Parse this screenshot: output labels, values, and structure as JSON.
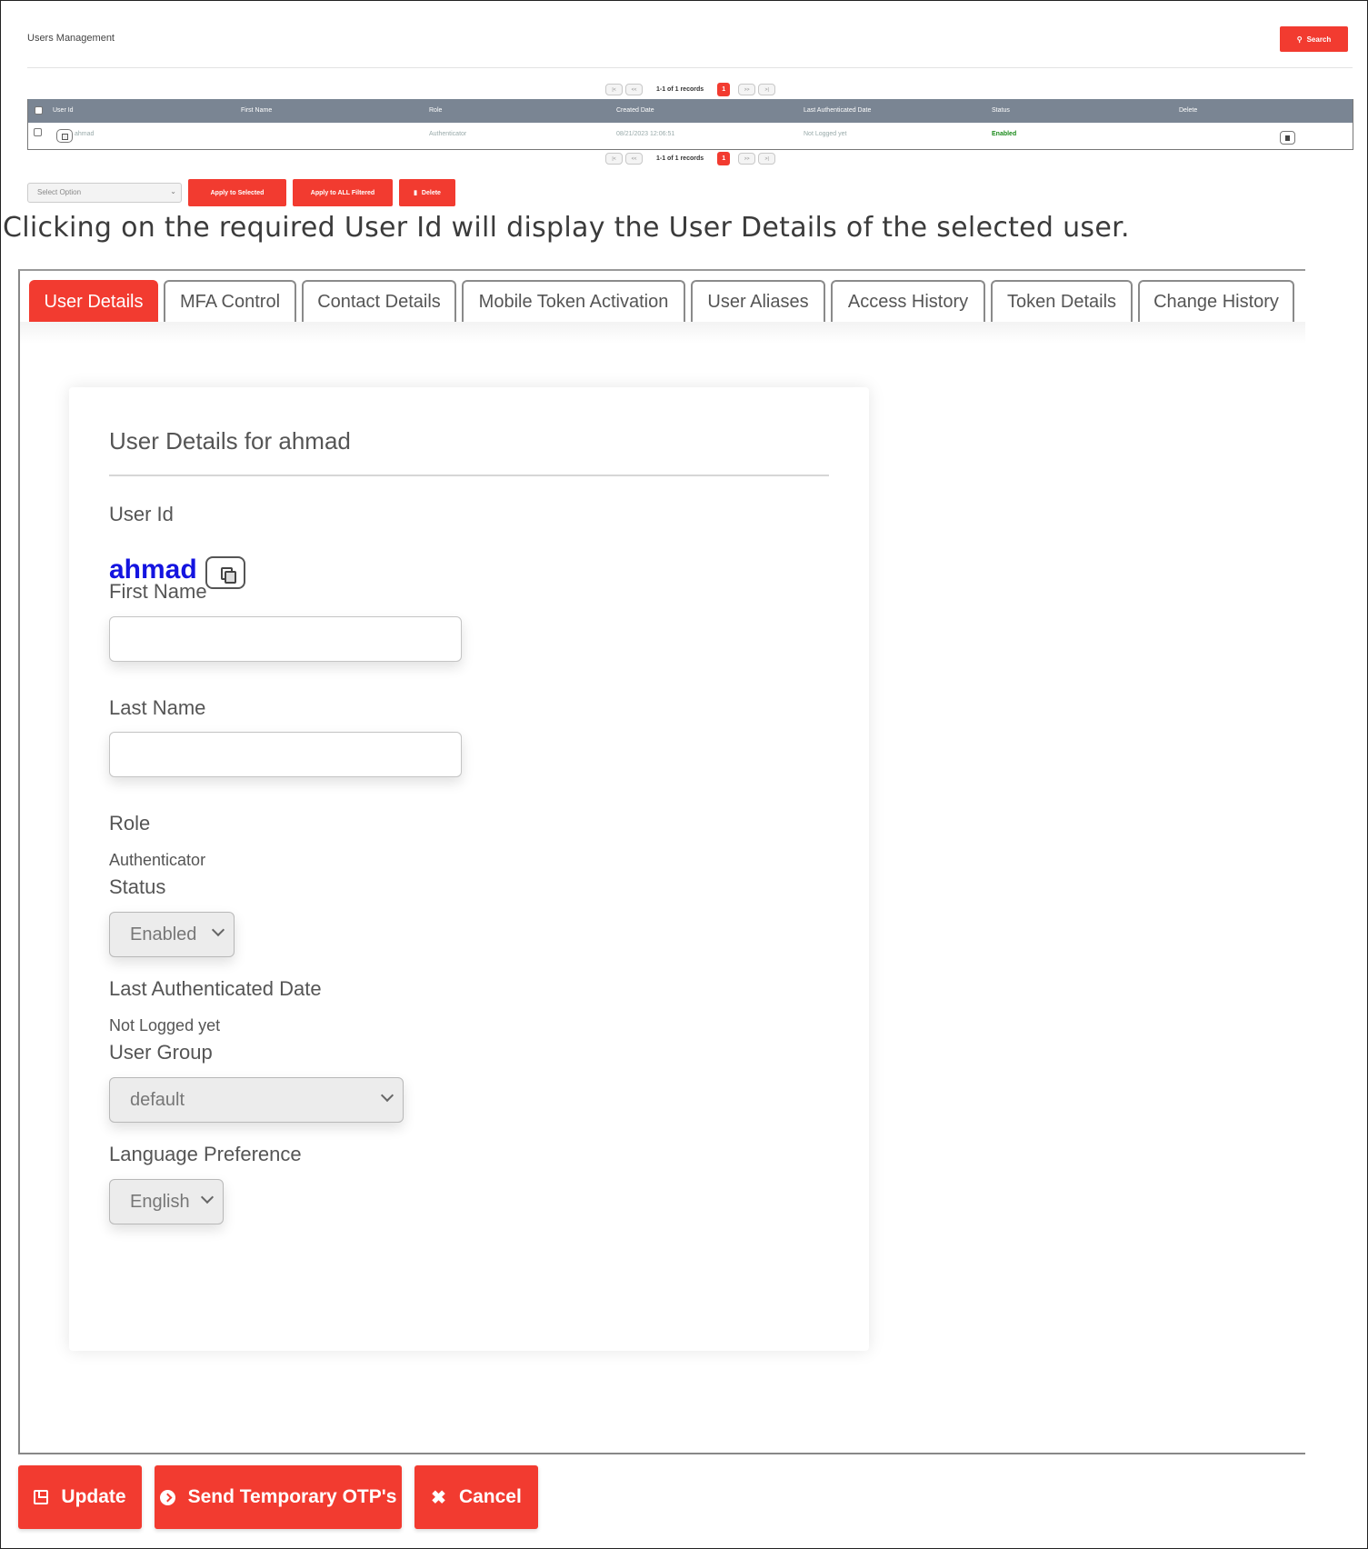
{
  "users_management": {
    "title": "Users Management",
    "search_label": "Search",
    "pager": {
      "info": "1-1 of 1 records",
      "current_page": "1",
      "first": "|<",
      "prev": "<<",
      "next": ">>",
      "last": ">|"
    },
    "columns": [
      "User Id",
      "First Name",
      "Role",
      "Created Date",
      "Last Authenticated Date",
      "Status",
      "Delete"
    ],
    "rows": [
      {
        "user_id": "ahmad",
        "first_name": "",
        "role": "Authenticator",
        "created_date": "08/21/2023 12:06:51",
        "last_authenticated": "Not Logged yet",
        "status": "Enabled"
      }
    ],
    "bulk": {
      "select_placeholder": "Select Option",
      "apply_selected": "Apply to Selected",
      "apply_all": "Apply to ALL Filtered",
      "delete": "Delete"
    }
  },
  "caption": "Clicking on the required User Id will display the User Details of the selected user.",
  "user_details": {
    "tabs": [
      {
        "label": "User Details",
        "active": true
      },
      {
        "label": "MFA Control",
        "active": false
      },
      {
        "label": "Contact Details",
        "active": false
      },
      {
        "label": "Mobile Token Activation",
        "active": false
      },
      {
        "label": "User Aliases",
        "active": false
      },
      {
        "label": "Access History",
        "active": false
      },
      {
        "label": "Token Details",
        "active": false
      },
      {
        "label": "Change History",
        "active": false
      }
    ],
    "card_title": "User Details for ahmad",
    "user_id_label": "User Id",
    "user_id_value": "ahmad",
    "first_name_label": "First Name",
    "first_name_value": "",
    "last_name_label": "Last Name",
    "last_name_value": "",
    "role_label": "Role",
    "role_value": "Authenticator",
    "status_label": "Status",
    "status_value": "Enabled",
    "last_auth_label": "Last Authenticated Date",
    "last_auth_value": "Not Logged yet",
    "user_group_label": "User Group",
    "user_group_value": "default",
    "language_label": "Language Preference",
    "language_value": "English"
  },
  "actions": {
    "update": "Update",
    "send_otp": "Send Temporary OTP's",
    "cancel": "Cancel"
  },
  "colors": {
    "accent": "#f23b30",
    "table_header": "#7a8593",
    "user_id_link": "#1414e0",
    "status_enabled": "#1a8a1a"
  }
}
